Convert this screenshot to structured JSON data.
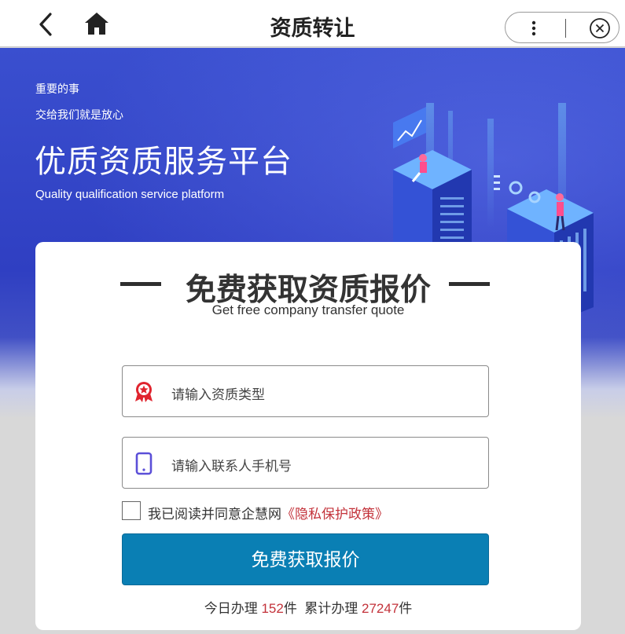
{
  "topbar": {
    "title": "资质转让",
    "back_icon": "chevron-left-icon",
    "home_icon": "home-icon",
    "more_icon": "more-vertical-icon",
    "close_icon": "close-circle-icon"
  },
  "banner": {
    "line1": "重要的事",
    "line2": "交给我们就是放心",
    "headline": "优质资质服务平台",
    "subheadline": "Quality qualification service platform"
  },
  "form": {
    "title": "免费获取资质报价",
    "subtitle": "Get free company transfer quote",
    "qualification_placeholder": "请输入资质类型",
    "phone_placeholder": "请输入联系人手机号",
    "agree_text": "我已阅读并同意企慧网",
    "policy_link": "《隐私保护政策》",
    "agree_checked": false,
    "submit_label": "免费获取报价"
  },
  "stats": {
    "today_label": "今日办理",
    "today_count": "152",
    "unit1": "件",
    "total_label": "累计办理",
    "total_count": "27247",
    "unit2": "件"
  },
  "colors": {
    "banner": "#2f3fc2",
    "button": "#0a7fb4",
    "accent_red": "#c3323a",
    "phone_icon": "#5b4fd8"
  }
}
